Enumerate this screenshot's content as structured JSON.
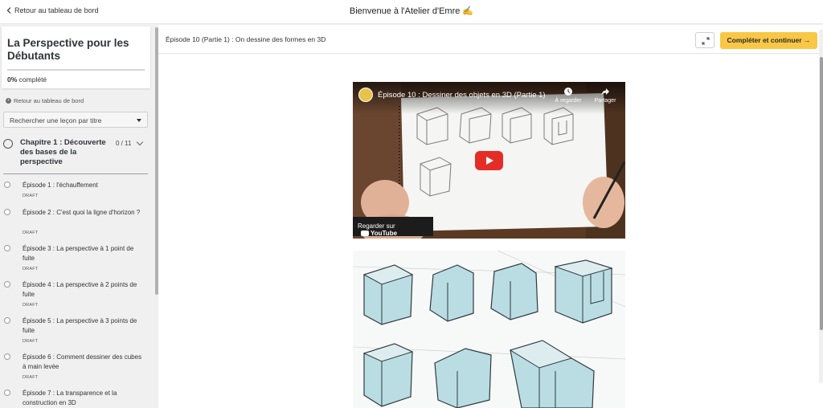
{
  "topbar": {
    "back_label": "Retour au tableau de bord",
    "title": "Bienvenue à l'Atelier d'Emre ✍️"
  },
  "sidebar": {
    "course_title": "La Perspective pour les Débutants",
    "progress_value": "0%",
    "progress_suffix": "complété",
    "progress_fraction": 0,
    "back_label": "Retour au tableau de bord",
    "search_placeholder": "Rechercher une leçon par titre",
    "chapter": {
      "title": "Chapitre 1 : Découverte des bases de la perspective",
      "count": "0 / 11"
    },
    "lessons": [
      {
        "title": "Épisode 1 : l'échauffement",
        "status": "DRAFT"
      },
      {
        "title": "Épisode 2 : C'est quoi la ligne d'horizon ?",
        "status": "DRAFT"
      },
      {
        "title": "Épisode 3 : La perspective à 1 point de fuite",
        "status": "DRAFT"
      },
      {
        "title": "Épisode 4 : La perspective à 2 points de fuite",
        "status": "DRAFT"
      },
      {
        "title": "Épisode 5 : La perspective à 3 points de fuite",
        "status": "DRAFT"
      },
      {
        "title": "Épisode 6 : Comment dessiner des cubes à main levée",
        "status": "DRAFT"
      },
      {
        "title": "Épisode 7 : La transparence et la construction en 3D",
        "status": ""
      }
    ]
  },
  "main": {
    "episode_title": "Épisode 10 (Partie 1) : On dessine des formes en 3D",
    "complete_button": "Compléter et continuer →",
    "video": {
      "title": "Épisode 10 : Dessiner des objets en 3D (Partie 1)",
      "watch_later": "À regarder ...",
      "share": "Partager",
      "watch_on": "Regarder sur",
      "youtube": "YouTube"
    }
  },
  "colors": {
    "accent": "#f8c746",
    "play": "#e52d27"
  }
}
